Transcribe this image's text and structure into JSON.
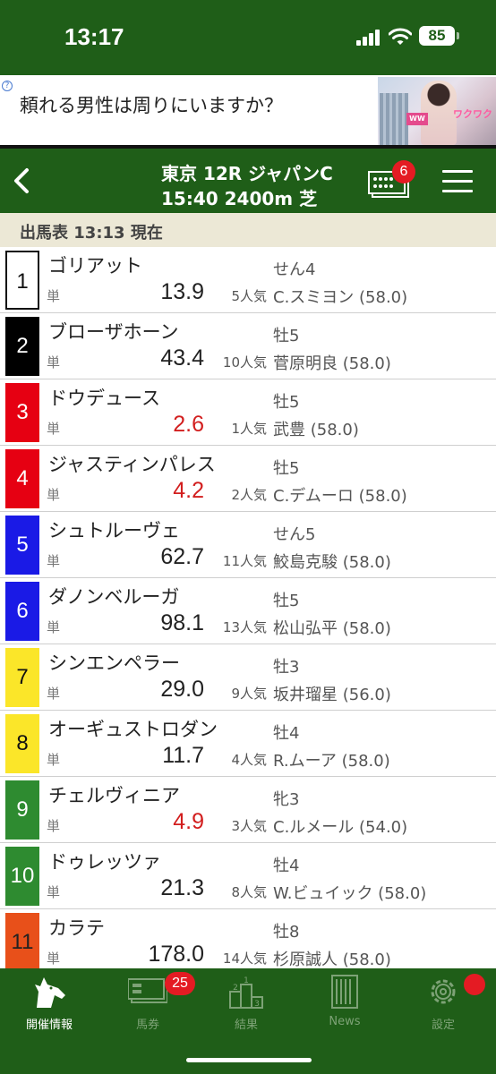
{
  "status_bar": {
    "time": "13:17",
    "battery": "85"
  },
  "ad": {
    "text": "頼れる男性は周りにいますか？",
    "image_text": "ワクワク"
  },
  "header": {
    "title_line1": "東京 12R ジャパンC",
    "title_line2": "15:40 2400m 芝",
    "ticket_badge": "6"
  },
  "subheader": {
    "label": "出馬表 13:13 現在"
  },
  "runners": [
    {
      "num": "1",
      "name": "ゴリアット",
      "tan": "単",
      "odds": "13.9",
      "popularity": "5人気",
      "sex_age": "せん4",
      "jockey": "C.スミヨン (58.0)",
      "bg": "#ffffff",
      "fg": "#111111",
      "favored": false
    },
    {
      "num": "2",
      "name": "ブローザホーン",
      "tan": "単",
      "odds": "43.4",
      "popularity": "10人気",
      "sex_age": "牡5",
      "jockey": "菅原明良 (58.0)",
      "bg": "#000000",
      "fg": "#ffffff",
      "favored": false
    },
    {
      "num": "3",
      "name": "ドウデュース",
      "tan": "単",
      "odds": "2.6",
      "popularity": "1人気",
      "sex_age": "牡5",
      "jockey": "武豊 (58.0)",
      "bg": "#e60012",
      "fg": "#ffffff",
      "favored": true
    },
    {
      "num": "4",
      "name": "ジャスティンパレス",
      "tan": "単",
      "odds": "4.2",
      "popularity": "2人気",
      "sex_age": "牡5",
      "jockey": "C.デムーロ (58.0)",
      "bg": "#e60012",
      "fg": "#ffffff",
      "favored": true
    },
    {
      "num": "5",
      "name": "シュトルーヴェ",
      "tan": "単",
      "odds": "62.7",
      "popularity": "11人気",
      "sex_age": "せん5",
      "jockey": "鮫島克駿 (58.0)",
      "bg": "#1a1ae6",
      "fg": "#ffffff",
      "favored": false
    },
    {
      "num": "6",
      "name": "ダノンベルーガ",
      "tan": "単",
      "odds": "98.1",
      "popularity": "13人気",
      "sex_age": "牡5",
      "jockey": "松山弘平 (58.0)",
      "bg": "#1a1ae6",
      "fg": "#ffffff",
      "favored": false
    },
    {
      "num": "7",
      "name": "シンエンペラー",
      "tan": "単",
      "odds": "29.0",
      "popularity": "9人気",
      "sex_age": "牡3",
      "jockey": "坂井瑠星 (56.0)",
      "bg": "#fbe629",
      "fg": "#111111",
      "favored": false
    },
    {
      "num": "8",
      "name": "オーギュストロダン",
      "tan": "単",
      "odds": "11.7",
      "popularity": "4人気",
      "sex_age": "牡4",
      "jockey": "R.ムーア (58.0)",
      "bg": "#fbe629",
      "fg": "#111111",
      "favored": false
    },
    {
      "num": "9",
      "name": "チェルヴィニア",
      "tan": "単",
      "odds": "4.9",
      "popularity": "3人気",
      "sex_age": "牝3",
      "jockey": "C.ルメール (54.0)",
      "bg": "#2e8b30",
      "fg": "#ffffff",
      "favored": true
    },
    {
      "num": "10",
      "name": "ドゥレッツァ",
      "tan": "単",
      "odds": "21.3",
      "popularity": "8人気",
      "sex_age": "牡4",
      "jockey": "W.ビュイック (58.0)",
      "bg": "#2e8b30",
      "fg": "#ffffff",
      "favored": false
    },
    {
      "num": "11",
      "name": "カラテ",
      "tan": "単",
      "odds": "178.0",
      "popularity": "14人気",
      "sex_age": "牡8",
      "jockey": "杉原誠人 (58.0)",
      "bg": "#e8501a",
      "fg": "#222222",
      "favored": false
    }
  ],
  "tabs": [
    {
      "label": "開催情報",
      "icon": "horse-head-icon",
      "active": true
    },
    {
      "label": "馬券",
      "icon": "ticket-icon",
      "badge": "25",
      "active": false
    },
    {
      "label": "結果",
      "icon": "podium-icon",
      "active": false
    },
    {
      "label": "News",
      "icon": "newspaper-icon",
      "active": false
    },
    {
      "label": "設定",
      "icon": "gear-icon",
      "active": false
    }
  ],
  "colors": {
    "header_green": "#1f5e18",
    "favored_red": "#d21e1e",
    "subheader_beige": "#ece8d6"
  }
}
